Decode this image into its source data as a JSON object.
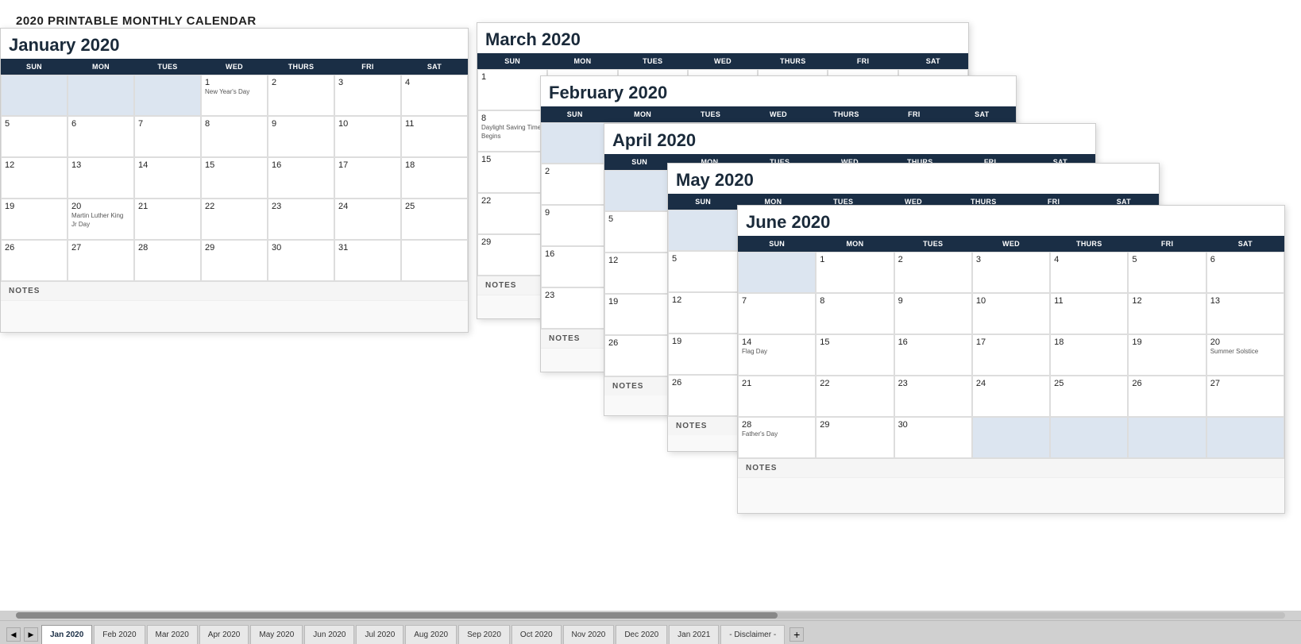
{
  "page": {
    "title": "2020 PRINTABLE MONTHLY CALENDAR"
  },
  "tabs": [
    {
      "label": "Jan 2020",
      "active": true
    },
    {
      "label": "Feb 2020",
      "active": false
    },
    {
      "label": "Mar 2020",
      "active": false
    },
    {
      "label": "Apr 2020",
      "active": false
    },
    {
      "label": "May 2020",
      "active": false
    },
    {
      "label": "Jun 2020",
      "active": false
    },
    {
      "label": "Jul 2020",
      "active": false
    },
    {
      "label": "Aug 2020",
      "active": false
    },
    {
      "label": "Sep 2020",
      "active": false
    },
    {
      "label": "Oct 2020",
      "active": false
    },
    {
      "label": "Nov 2020",
      "active": false
    },
    {
      "label": "Dec 2020",
      "active": false
    },
    {
      "label": "Jan 2021",
      "active": false
    },
    {
      "label": "- Disclaimer -",
      "active": false
    }
  ],
  "calendars": {
    "january": {
      "title": "January 2020",
      "headers": [
        "SUN",
        "MON",
        "TUES",
        "WED",
        "THURS",
        "FRI",
        "SAT"
      ]
    },
    "february": {
      "title": "February 2020"
    },
    "march": {
      "title": "March 2020"
    },
    "april": {
      "title": "April 2020"
    },
    "may": {
      "title": "May 2020"
    },
    "june": {
      "title": "June 2020",
      "headers": [
        "SUN",
        "MON",
        "TUES",
        "WED",
        "THURS",
        "FRI",
        "SAT"
      ]
    }
  },
  "notes_label": "NOTES"
}
